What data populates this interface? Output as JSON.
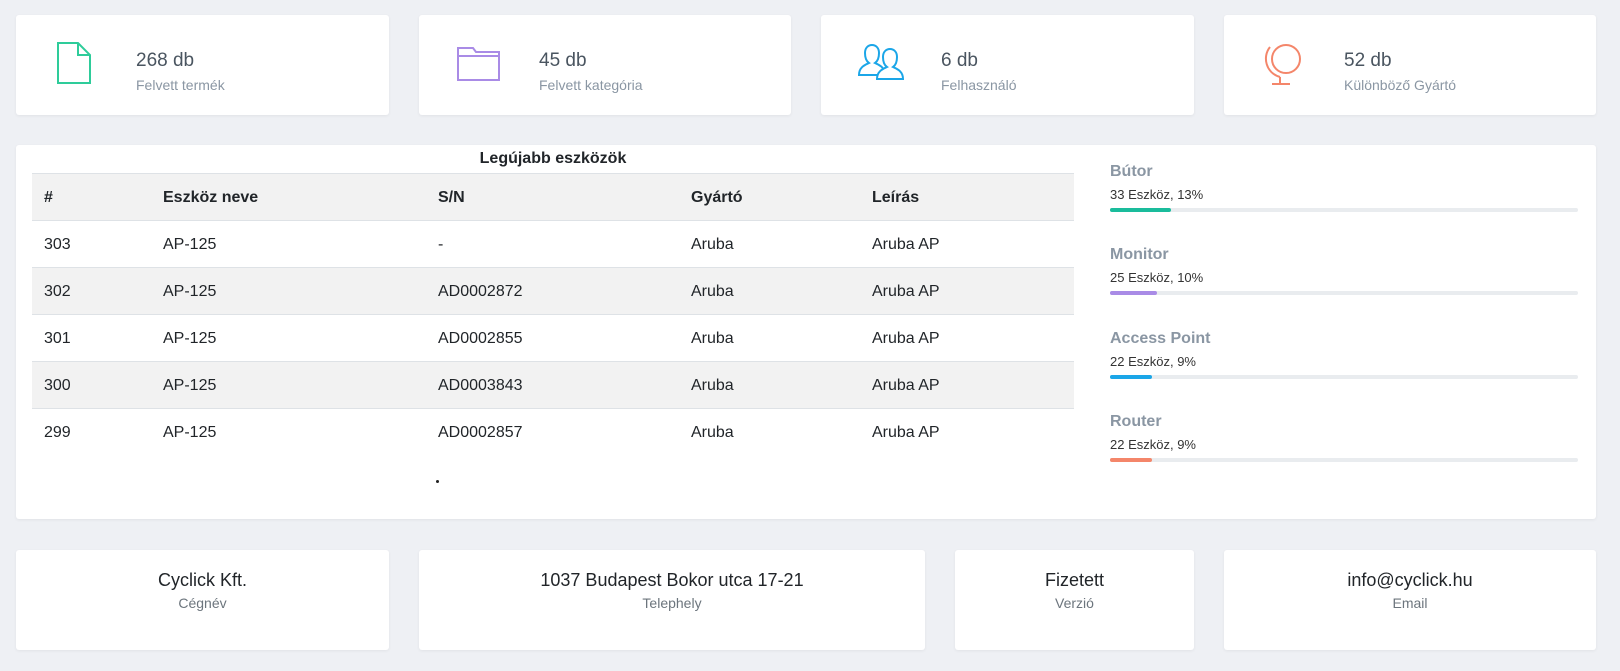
{
  "stats": [
    {
      "value": "268 db",
      "label": "Felvett termék",
      "icon": "file-icon",
      "color": "#2ecc9a"
    },
    {
      "value": "45 db",
      "label": "Felvett kategória",
      "icon": "folder-icon",
      "color": "#a98be6"
    },
    {
      "value": "6 db",
      "label": "Felhasználó",
      "icon": "users-icon",
      "color": "#1ba6e8"
    },
    {
      "value": "52 db",
      "label": "Különböző Gyártó",
      "icon": "globe-icon",
      "color": "#f4866a"
    }
  ],
  "table": {
    "title": "Legújabb eszközök",
    "headers": [
      "#",
      "Eszköz neve",
      "S/N",
      "Gyártó",
      "Leírás"
    ],
    "rows": [
      [
        "303",
        "AP-125",
        "-",
        "Aruba",
        "Aruba AP"
      ],
      [
        "302",
        "AP-125",
        "AD0002872",
        "Aruba",
        "Aruba AP"
      ],
      [
        "301",
        "AP-125",
        "AD0002855",
        "Aruba",
        "Aruba AP"
      ],
      [
        "300",
        "AP-125",
        "AD0003843",
        "Aruba",
        "Aruba AP"
      ],
      [
        "299",
        "AP-125",
        "AD0002857",
        "Aruba",
        "Aruba AP"
      ]
    ]
  },
  "categories": [
    {
      "name": "Bútor",
      "subtitle": "33 Eszköz, 13%",
      "percent": 13,
      "color": "#1abc9c"
    },
    {
      "name": "Monitor",
      "subtitle": "25 Eszköz, 10%",
      "percent": 10,
      "color": "#a98be6"
    },
    {
      "name": "Access Point",
      "subtitle": "22 Eszköz, 9%",
      "percent": 9,
      "color": "#1ba6e8"
    },
    {
      "name": "Router",
      "subtitle": "22 Eszköz, 9%",
      "percent": 9,
      "color": "#f4866a"
    }
  ],
  "info": [
    {
      "value": "Cyclick Kft.",
      "label": "Cégnév"
    },
    {
      "value": "1037 Budapest Bokor utca 17-21",
      "label": "Telephely"
    },
    {
      "value": "Fizetett",
      "label": "Verzió"
    },
    {
      "value": "info@cyclick.hu",
      "label": "Email"
    }
  ]
}
